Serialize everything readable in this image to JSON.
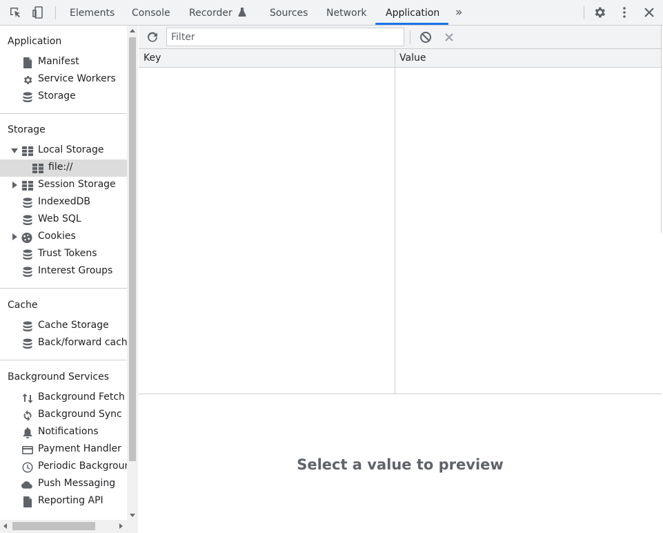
{
  "toolbar": {
    "tabs": [
      {
        "label": "Elements"
      },
      {
        "label": "Console"
      },
      {
        "label": "Recorder"
      },
      {
        "label": "Sources"
      },
      {
        "label": "Network"
      },
      {
        "label": "Application"
      }
    ],
    "active_tab": "Application",
    "more_tabs": "»"
  },
  "sidebar": {
    "sections": {
      "application": {
        "title": "Application",
        "items": [
          {
            "label": "Manifest",
            "icon": "file-icon"
          },
          {
            "label": "Service Workers",
            "icon": "gear-icon"
          },
          {
            "label": "Storage",
            "icon": "database-icon"
          }
        ]
      },
      "storage": {
        "title": "Storage",
        "items": [
          {
            "label": "Local Storage",
            "icon": "table-icon",
            "expanded": true
          },
          {
            "label": "file://",
            "icon": "table-icon",
            "selected": true
          },
          {
            "label": "Session Storage",
            "icon": "table-icon",
            "expanded": false
          },
          {
            "label": "IndexedDB",
            "icon": "database-icon"
          },
          {
            "label": "Web SQL",
            "icon": "database-icon"
          },
          {
            "label": "Cookies",
            "icon": "cookie-icon",
            "expanded": false
          },
          {
            "label": "Trust Tokens",
            "icon": "database-icon"
          },
          {
            "label": "Interest Groups",
            "icon": "database-icon"
          }
        ]
      },
      "cache": {
        "title": "Cache",
        "items": [
          {
            "label": "Cache Storage",
            "icon": "database-icon"
          },
          {
            "label": "Back/forward cache",
            "icon": "database-icon"
          }
        ]
      },
      "background": {
        "title": "Background Services",
        "items": [
          {
            "label": "Background Fetch",
            "icon": "arrows-updown-icon"
          },
          {
            "label": "Background Sync",
            "icon": "sync-icon"
          },
          {
            "label": "Notifications",
            "icon": "bell-icon"
          },
          {
            "label": "Payment Handler",
            "icon": "credit-card-icon"
          },
          {
            "label": "Periodic Background Sync",
            "icon": "clock-icon"
          },
          {
            "label": "Push Messaging",
            "icon": "cloud-icon"
          },
          {
            "label": "Reporting API",
            "icon": "file-icon"
          }
        ]
      }
    }
  },
  "filter": {
    "placeholder": "Filter",
    "value": ""
  },
  "grid": {
    "columns": [
      "Key",
      "Value"
    ],
    "rows": []
  },
  "preview": {
    "message": "Select a value to preview"
  },
  "colors": {
    "accent": "#1a73e8",
    "toolbar_bg": "#f1f3f4",
    "selected_row": "#dcdcdc",
    "icon": "#5f6368"
  }
}
